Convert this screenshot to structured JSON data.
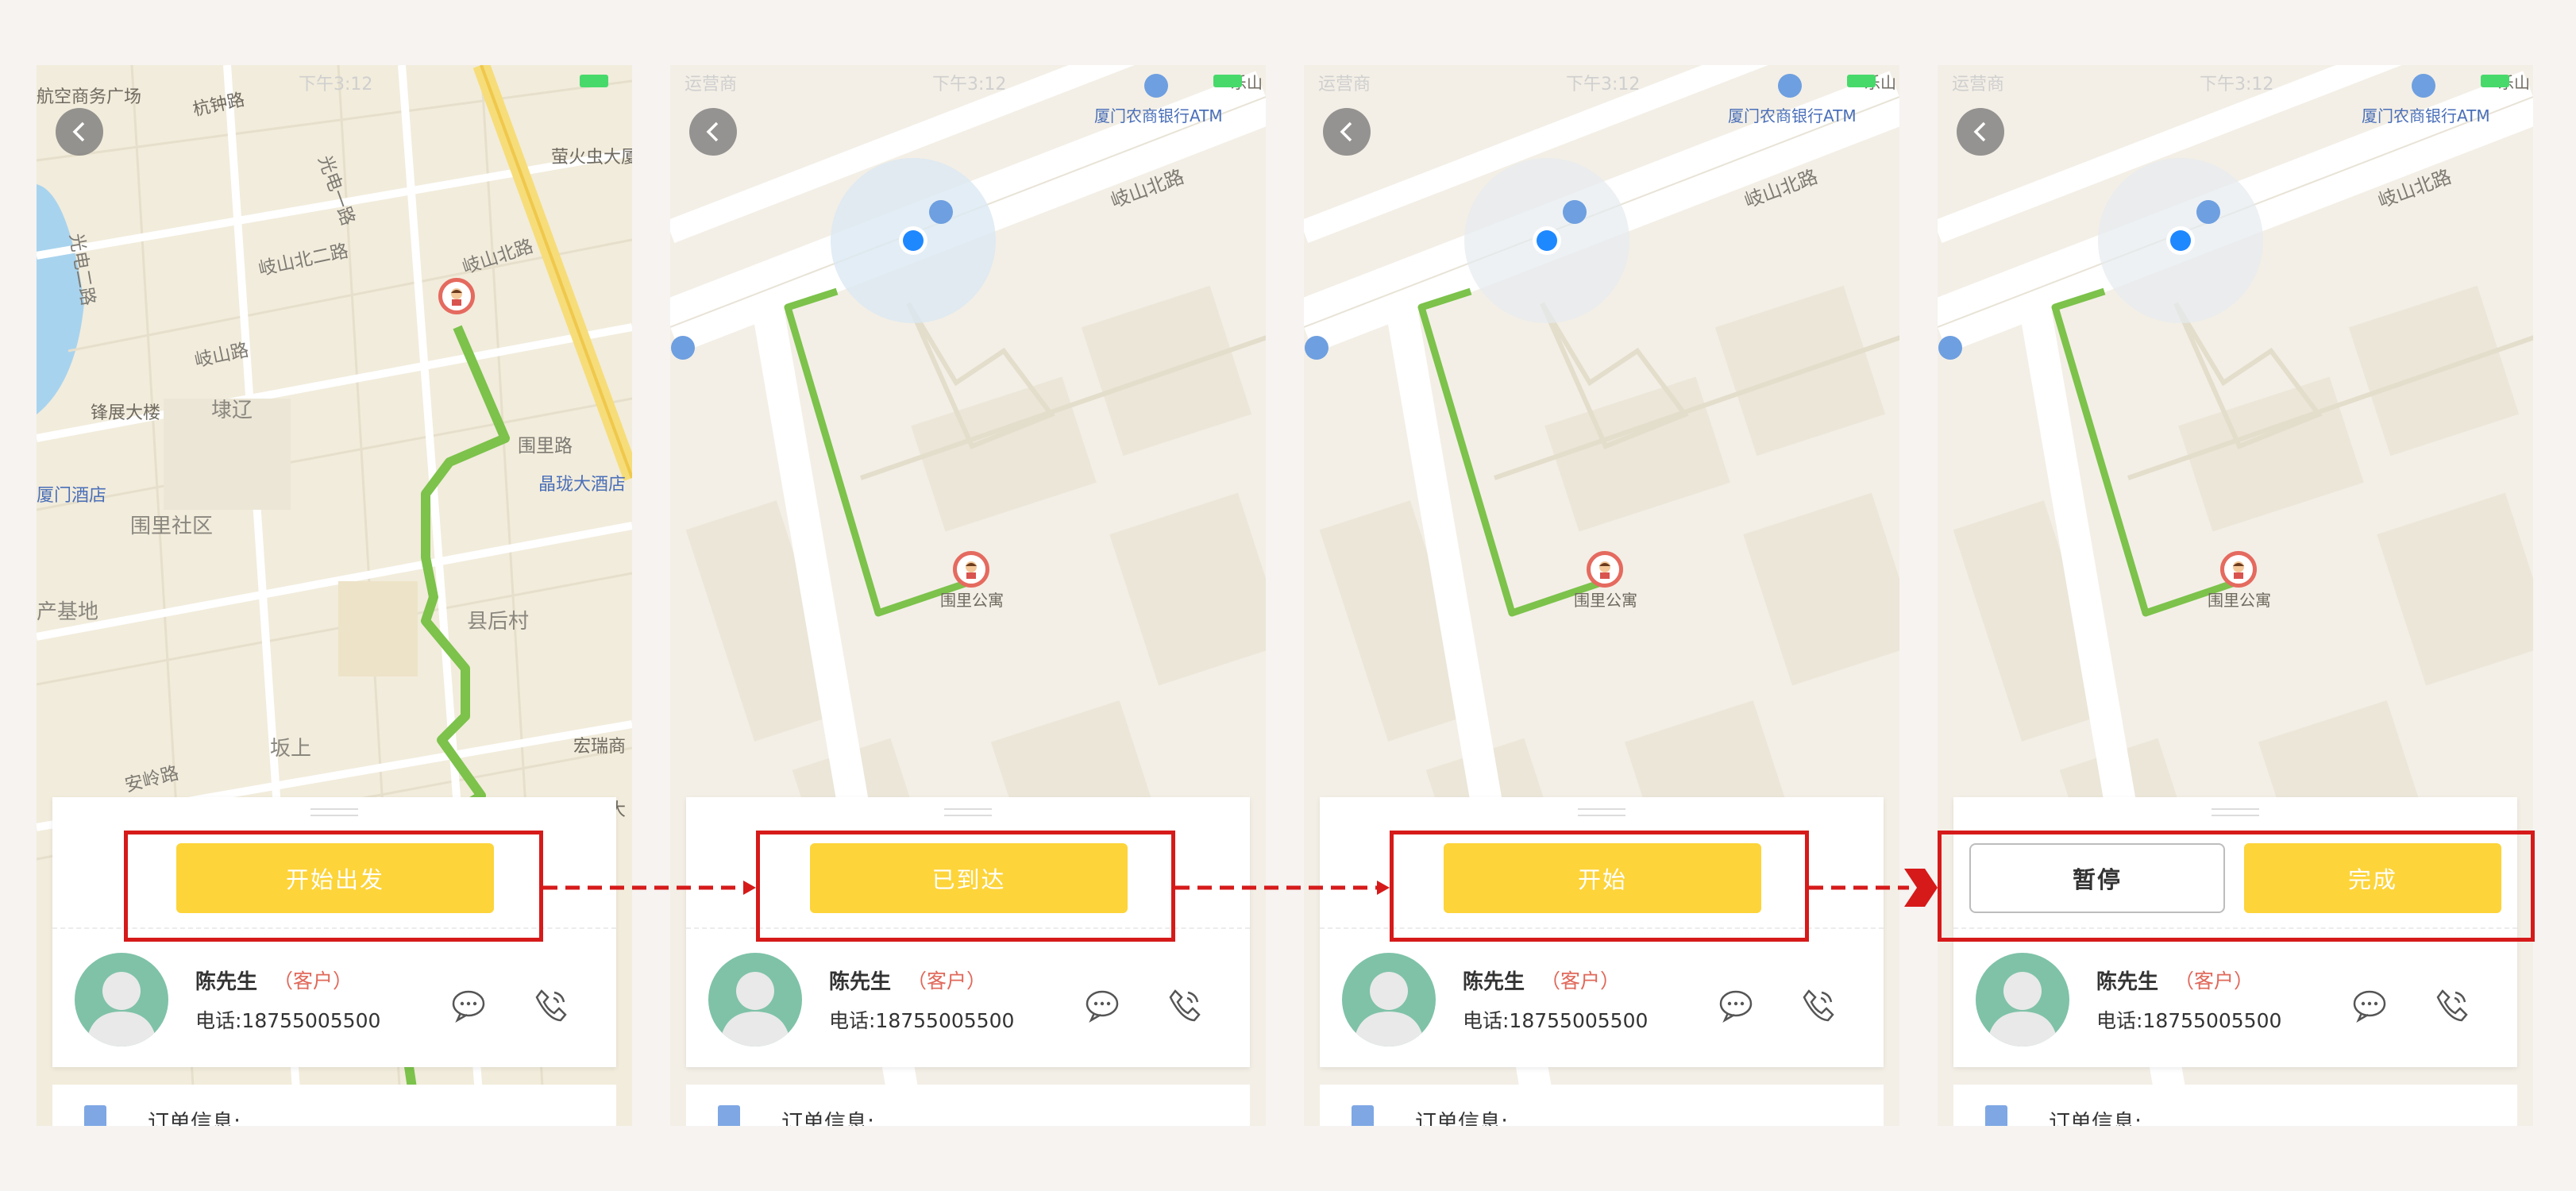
{
  "status_bar": {
    "carrier": "运营商",
    "time": "下午3:12"
  },
  "map": {
    "first": {
      "labels": [
        "航空商务广场",
        "杭钟路",
        "光电一路",
        "光电二路",
        "岐山北二路",
        "岐山北路",
        "岐山路",
        "锋展大楼",
        "埭辽",
        "围里路",
        "晶珑大酒店",
        "围里社区",
        "县后村",
        "坂上",
        "安岭路",
        "宏瑞商",
        "萤火虫大厦",
        "厦门酒店",
        "产基地",
        "大"
      ],
      "pin_label": ""
    },
    "zoomed": {
      "labels": [
        "厦门农商银行ATM",
        "岐山北路",
        "乐山",
        "ATM"
      ],
      "pin_label": "围里公寓"
    }
  },
  "screens": [
    {
      "id": "s1",
      "buttons": [
        {
          "label": "开始出发",
          "style": "primary"
        }
      ]
    },
    {
      "id": "s2",
      "buttons": [
        {
          "label": "已到达",
          "style": "primary"
        }
      ]
    },
    {
      "id": "s3",
      "buttons": [
        {
          "label": "开始",
          "style": "primary"
        }
      ]
    },
    {
      "id": "s4",
      "buttons": [
        {
          "label": "暂停",
          "style": "outline"
        },
        {
          "label": "完成",
          "style": "primary"
        }
      ]
    }
  ],
  "customer": {
    "name": "陈先生",
    "tag": "（客户）",
    "phone": "电话:18755005500"
  },
  "order": {
    "title": "订单信息:"
  },
  "colors": {
    "accent_yellow": "#fdd43a",
    "route_green": "#7cc24b",
    "highlight_red": "#d61a1a",
    "pin_red": "#e56a5f",
    "location_blue": "#1e88ff"
  },
  "icons": [
    "back-arrow-icon",
    "message-icon",
    "phone-icon",
    "document-icon",
    "user-avatar-icon",
    "location-dot-icon",
    "customer-pin-icon",
    "bus-stop-icon",
    "atm-icon",
    "wifi-icon",
    "battery-icon"
  ]
}
